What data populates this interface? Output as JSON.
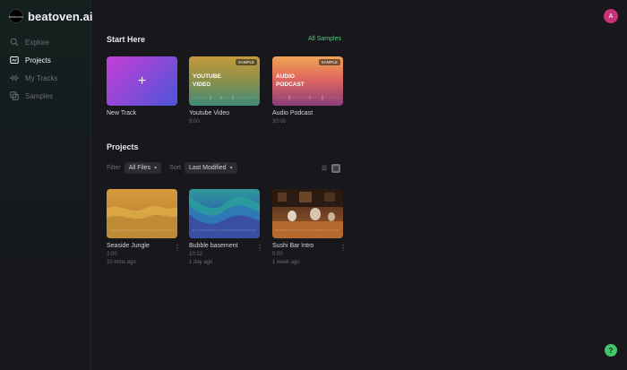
{
  "app": {
    "name": "beatoven.ai",
    "logo_text": "beatoven"
  },
  "sidebar": {
    "items": [
      {
        "label": "Explore",
        "icon": "search-icon",
        "active": false
      },
      {
        "label": "Projects",
        "icon": "projects-icon",
        "active": true
      },
      {
        "label": "My Tracks",
        "icon": "waveform-icon",
        "active": false
      },
      {
        "label": "Samples",
        "icon": "samples-icon",
        "active": false
      }
    ]
  },
  "user": {
    "initial": "A"
  },
  "help": {
    "label": "?"
  },
  "start_here": {
    "title": "Start Here",
    "all_samples": "All Samples",
    "cards": [
      {
        "title": "New Track",
        "plus": "+"
      },
      {
        "title": "Youtube Video",
        "subtitle": "9:00",
        "label": "YOUTUBE VIDEO",
        "badge": "SAMPLE"
      },
      {
        "title": "Audio Podcast",
        "subtitle": "30:00",
        "label": "AUDIO PODCAST",
        "badge": "SAMPLE"
      }
    ]
  },
  "projects": {
    "title": "Projects",
    "filter_label": "Filter",
    "filter_value": "All Files",
    "sort_label": "Sort",
    "sort_value": "Last Modified",
    "items": [
      {
        "title": "Seaside Jungle",
        "duration": "2:00",
        "modified": "10 mins ago"
      },
      {
        "title": "Bubble basement",
        "duration": "10:12",
        "modified": "1 day ago"
      },
      {
        "title": "Sushi Bar Intro",
        "duration": "5:00",
        "modified": "1 week ago"
      }
    ]
  },
  "colors": {
    "accent": "#4fcf7a",
    "avatar": "#c7327b",
    "background": "#17171c"
  }
}
